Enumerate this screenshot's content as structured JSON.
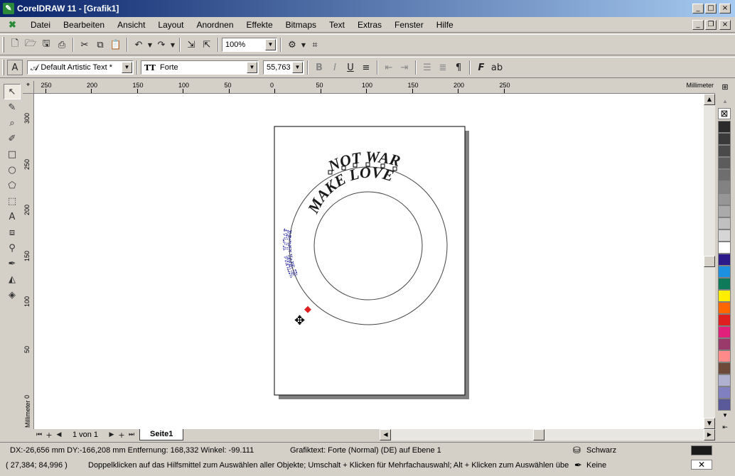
{
  "window": {
    "title": "CorelDRAW 11 - [Grafik1]"
  },
  "menu": [
    "Datei",
    "Bearbeiten",
    "Ansicht",
    "Layout",
    "Anordnen",
    "Effekte",
    "Bitmaps",
    "Text",
    "Extras",
    "Fenster",
    "Hilfe"
  ],
  "toolbar": {
    "zoom": "100%"
  },
  "propbar": {
    "style": "Default Artistic Text *",
    "font": "Forte",
    "size": "55,763"
  },
  "ruler": {
    "unit": "Millimeter",
    "h_labels": [
      "250",
      "200",
      "150",
      "100",
      "50",
      "0",
      "50",
      "100",
      "150",
      "200",
      "250"
    ],
    "v_labels": [
      "300",
      "250",
      "200",
      "150",
      "100",
      "50",
      "0"
    ]
  },
  "artwork": {
    "text_top": "NOT WAR",
    "text_inner": "MAKE LOVE",
    "text_side": "NOT WAR"
  },
  "nav": {
    "pages": "1 von 1",
    "tab": "Seite1"
  },
  "status": {
    "line1_left": "DX:-26,656 mm DY:-166,208 mm Entfernung: 168,332 Winkel: -99.111",
    "line1_mid": "Grafiktext: Forte (Normal) (DE) auf Ebene 1",
    "fill_label": "Schwarz",
    "line2_left": "( 27,384; 84,996 )",
    "line2_mid": "Doppelklicken auf das Hilfsmittel zum Auswählen aller Objekte; Umschalt + Klicken für Mehrfachauswahl; Alt + Klicken zum Auswählen überde...",
    "outline_label": "Keine"
  },
  "palette": [
    "#2b2b2b",
    "#3a3a3a",
    "#4a4a4a",
    "#5c5c5c",
    "#6e6e6e",
    "#828282",
    "#969696",
    "#aaaaaa",
    "#c0c0c0",
    "#d6d6d6",
    "#ffffff",
    "#2d1a8a",
    "#1e90e0",
    "#0e7a5a",
    "#ffee00",
    "#ff6600",
    "#e02020",
    "#e0207a",
    "#9a3a6a",
    "#ff8a8a",
    "#6e4a3a",
    "#b0b0d0",
    "#8080c0",
    "#5a5a9a"
  ],
  "colors": {
    "title_start": "#0a246a",
    "title_end": "#a6caf0",
    "selection_text": "#1a1a9a",
    "node": "#e02020"
  }
}
